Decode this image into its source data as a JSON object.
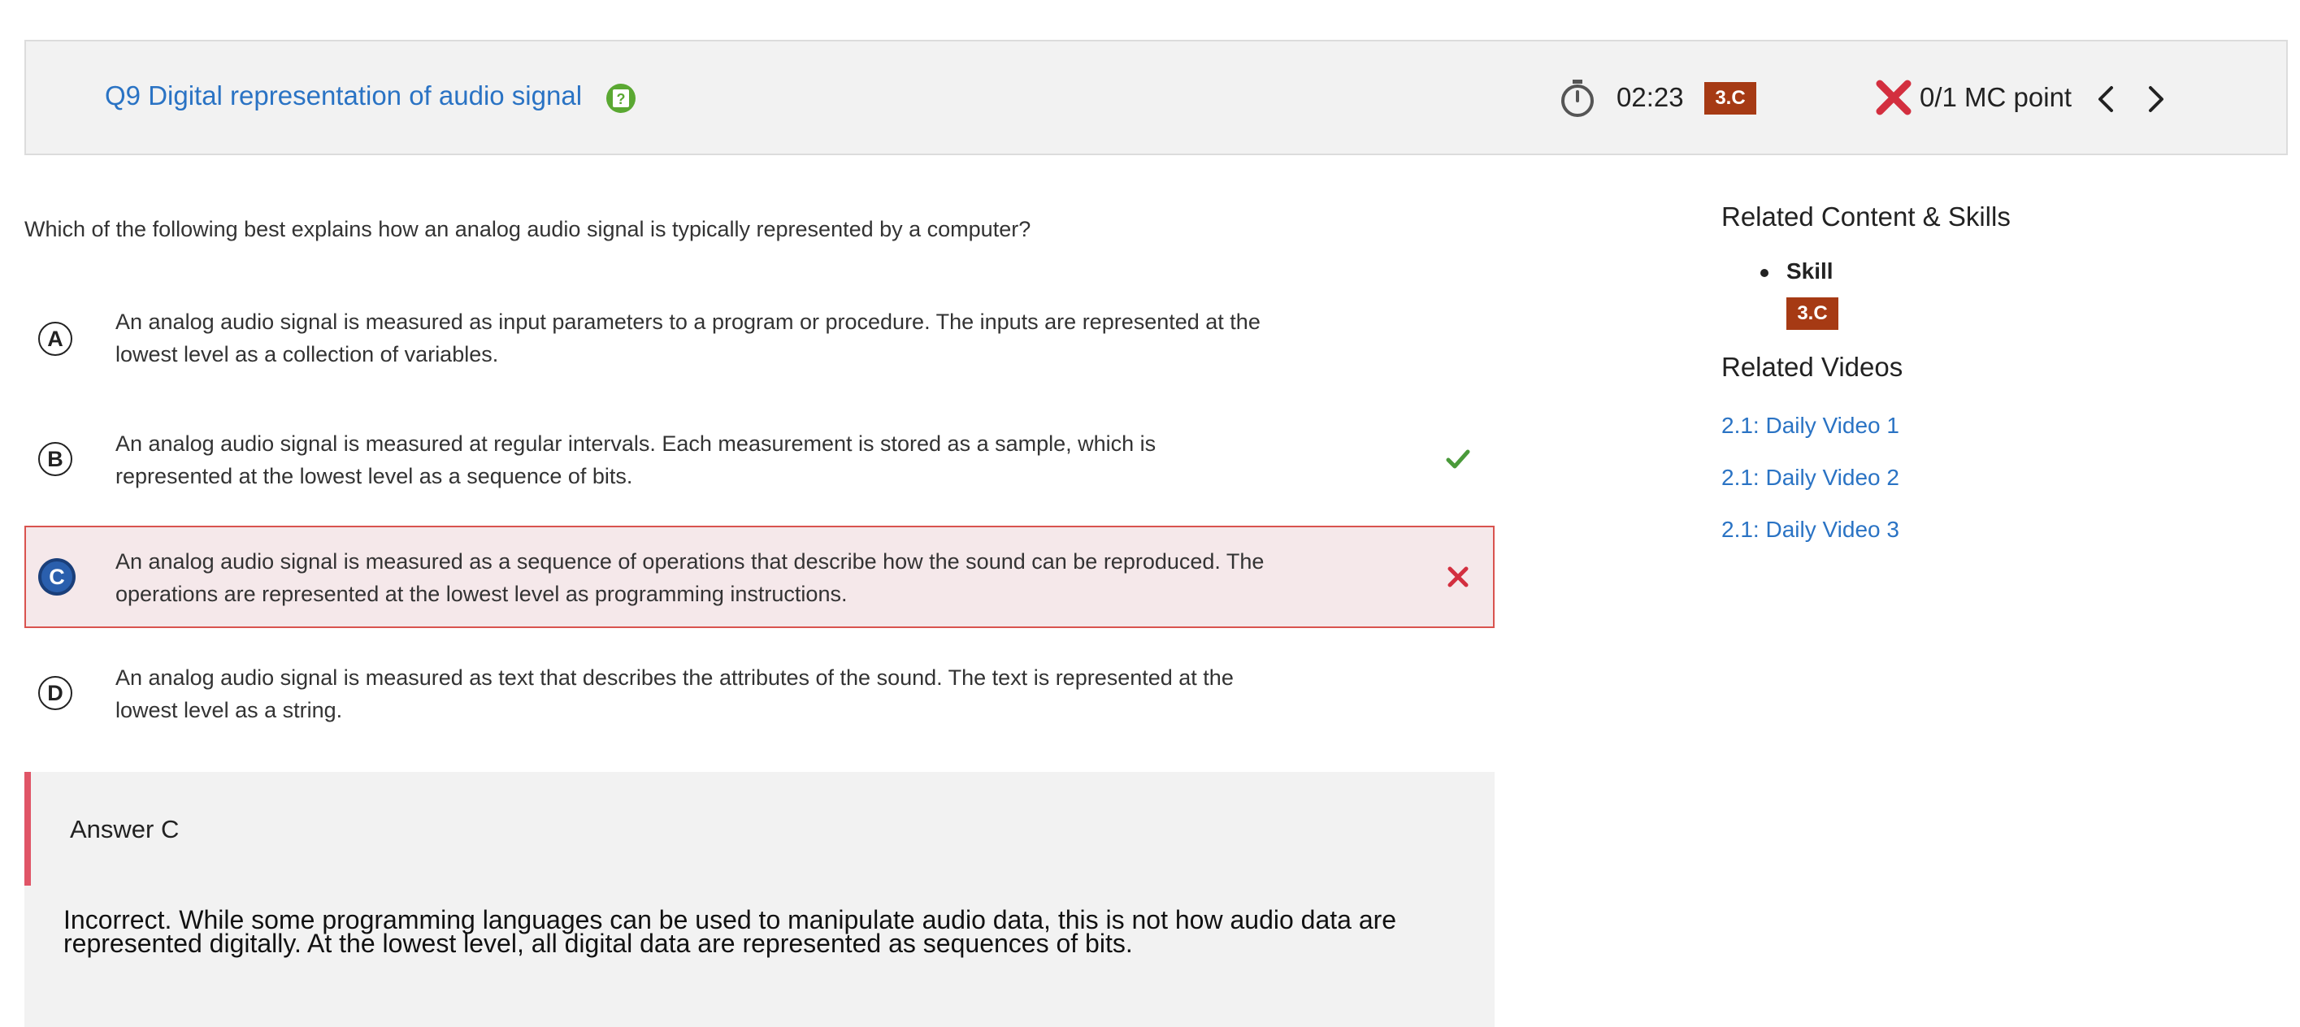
{
  "header": {
    "question_title": "Q9 Digital representation of audio signal",
    "timer": "02:23",
    "skill_badge": "3.C",
    "score": "0/1 MC point"
  },
  "question": {
    "text": "Which of the following best explains how an analog audio signal is typically represented by a computer?",
    "options": [
      {
        "letter": "A",
        "text": "An analog audio signal is measured as input parameters to a program or procedure. The inputs are represented at the lowest level as a collection of variables.",
        "mark": "none"
      },
      {
        "letter": "B",
        "text": "An analog audio signal is measured at regular intervals. Each measurement is stored as a sample, which is represented at the lowest level as a sequence of bits.",
        "mark": "correct"
      },
      {
        "letter": "C",
        "text": "An analog audio signal is measured as a sequence of operations that describe how the sound can be reproduced. The operations are represented at the lowest level as programming instructions.",
        "mark": "incorrect"
      },
      {
        "letter": "D",
        "text": "An analog audio signal is measured as text that describes the attributes of the sound. The text is represented at the lowest level as a string.",
        "mark": "none"
      }
    ]
  },
  "answer": {
    "title": "Answer C",
    "explanation": "Incorrect. While some programming languages can be used to manipulate audio data, this is not how audio data are represented digitally. At the lowest level, all digital data are represented as sequences of bits."
  },
  "sidebar": {
    "related_title": "Related Content & Skills",
    "skill_label": "Skill",
    "skill_badge": "3.C",
    "videos_title": "Related Videos",
    "videos": [
      "2.1: Daily Video 1",
      "2.1: Daily Video 2",
      "2.1: Daily Video 3"
    ]
  },
  "colors": {
    "link": "#2a73c4",
    "skill_badge_bg": "#a63a14",
    "selected_bg": "#f5e8ea",
    "incorrect": "#d32f3f",
    "correct": "#4a9a3a"
  },
  "icons": {
    "help": "help-icon",
    "timer": "stopwatch-icon",
    "score": "x-icon",
    "prev": "chevron-left-icon",
    "next": "chevron-right-icon",
    "correct_mark": "check-icon",
    "incorrect_mark": "close-icon"
  }
}
